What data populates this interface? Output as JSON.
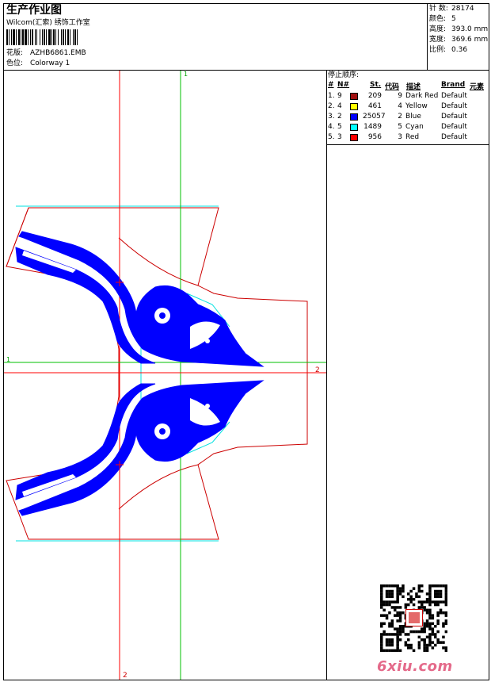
{
  "header": {
    "title": "生产作业图",
    "company": "Wilcom(汇索) 绣饰工作室",
    "design_label": "花版:",
    "design_value": "AZHB6861.EMB",
    "colorway_label": "色位:",
    "colorway_value": "Colorway 1"
  },
  "stats": {
    "stitches_label": "针 数:",
    "stitches_value": "28174",
    "colors_label": "颜色:",
    "colors_value": "5",
    "height_label": "高度:",
    "height_value": "393.0 mm",
    "width_label": "宽度:",
    "width_value": "369.6 mm",
    "scale_label": "比例:",
    "scale_value": "0.36"
  },
  "stop_sequence": {
    "title": "停止顺序:",
    "headers": {
      "num": "#",
      "n": "N#",
      "st": "St.",
      "code": "代码",
      "desc": "描述",
      "brand": "Brand",
      "element": "元素"
    },
    "rows": [
      {
        "num": "1.",
        "n": "9",
        "color": "#a01010",
        "st": "209",
        "code": "9",
        "desc": "Dark Red",
        "brand": "Default"
      },
      {
        "num": "2.",
        "n": "4",
        "color": "#ffff00",
        "st": "461",
        "code": "4",
        "desc": "Yellow",
        "brand": "Default"
      },
      {
        "num": "3.",
        "n": "2",
        "color": "#0000ff",
        "st": "25057",
        "code": "2",
        "desc": "Blue",
        "brand": "Default"
      },
      {
        "num": "4.",
        "n": "5",
        "color": "#00ffff",
        "st": "1489",
        "code": "5",
        "desc": "Cyan",
        "brand": "Default"
      },
      {
        "num": "5.",
        "n": "3",
        "color": "#ff0000",
        "st": "956",
        "code": "3",
        "desc": "Red",
        "brand": "Default"
      }
    ]
  },
  "guides": {
    "top_label": "1",
    "left_label": "1",
    "right_label": "2",
    "bottom_label": "2"
  },
  "watermark": {
    "text": "6xiu.com"
  },
  "colors": {
    "design_blue": "#0000ff",
    "guide_red": "#ff0000",
    "guide_green": "#00c000",
    "outline_red": "#cc0000",
    "cyan": "#00e0e0"
  }
}
